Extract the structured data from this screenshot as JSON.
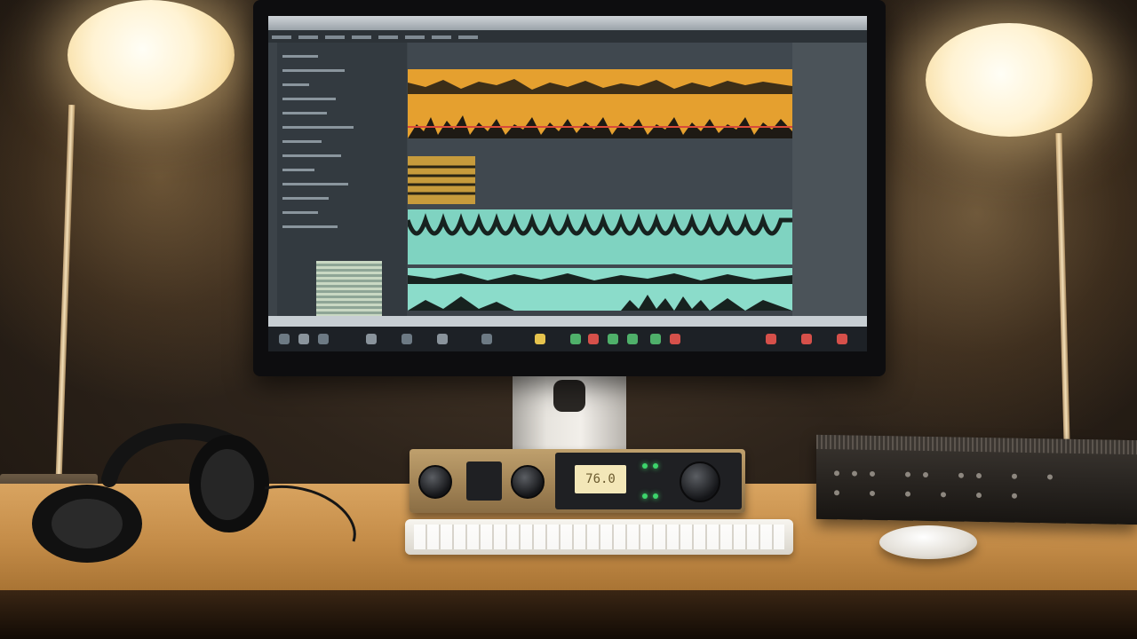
{
  "scene": {
    "description_items": [
      "desk-lamp-left",
      "desk-lamp-right",
      "monitor",
      "audio-interface",
      "keyboard",
      "mouse",
      "rack-unit",
      "headphones"
    ]
  },
  "audio_interface": {
    "display_text": "76.0"
  },
  "colors": {
    "waveform_orange": "#e5a02f",
    "waveform_teal": "#7fd3c1",
    "playhead_red": "#d94a3a",
    "lamp_glow": "#fff3d4"
  }
}
